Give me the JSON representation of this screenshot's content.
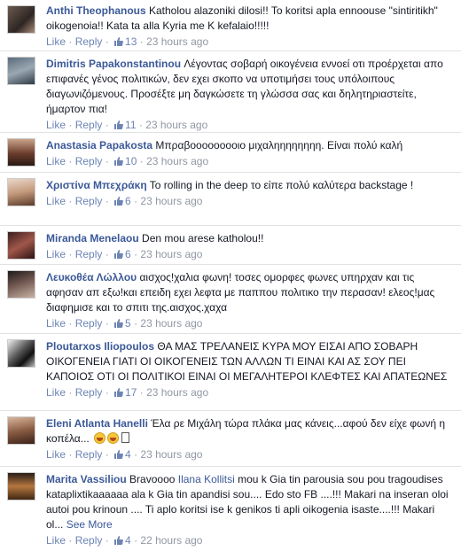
{
  "meta_labels": {
    "like": "Like",
    "reply": "Reply",
    "see_more": "See More"
  },
  "comments": [
    {
      "name": "Anthi Theophanous",
      "text": "Katholou alazoniki dilosi!! To koritsi apla ennoouse \"sintiritikh\" oikogenoia!! Kata ta alla Kyria me K kefalaio!!!!!",
      "likes": "13",
      "time": "23 hours ago"
    },
    {
      "name": "Dimitris Papakonstantinou",
      "text": "Λέγοντας σοβαρή οικογένεια εννοεί οτι προέρχεται απο επιφανές γένος πολιτικών, δεν εχει σκοπο να υποτιμήσει τους υπόλοιπους διαγωνιζόμενους. Προσέξτε μη δαγκώσετε τη γλώσσα σας και δηλητηριαστείτε, ήμαρτον πια!",
      "likes": "11",
      "time": "23 hours ago"
    },
    {
      "name": "Anastasia Papakosta",
      "text": "Μπραβοοοοοοοοιο μιχαληηηηηηηη. Είναι πολύ καλή",
      "likes": "10",
      "time": "23 hours ago"
    },
    {
      "name": "Χριστίνα Μπεχράκη",
      "text": "Το rolling in the deep το είπε πολύ καλύτερα backstage !",
      "likes": "6",
      "time": "23 hours ago"
    },
    {
      "name": "Miranda Menelaou",
      "text": "Den mou arese katholou!!",
      "likes": "6",
      "time": "23 hours ago"
    },
    {
      "name": "Λευκοθέα Λώλλου",
      "text": "αισχος!χαλια φωνη! τοσες ομορφες φωνες υπηρχαν και τις αφησαν απ εξω!και επειδη εχει λεφτα με παππου πολιτικο την περασαν! ελεος!μας διαφημισε και το σπιτι της.αισχος.χαχα",
      "likes": "5",
      "time": "23 hours ago"
    },
    {
      "name": "Ploutarxos Iliopoulos",
      "text": "ΘΑ ΜΑΣ ΤΡΕΛΑΝΕΙΣ ΚΥΡΑ ΜΟΥ ΕΙΣΑΙ ΑΠΟ ΣΟΒΑΡΗ ΟΙΚΟΓΕΝΕΙΑ ΓΙΑΤΙ ΟΙ ΟΙΚΟΓΕΝΕΙΣ ΤΩΝ ΑΛΛΩΝ ΤΙ ΕΙΝΑΙ ΚΑΙ ΑΣ ΣΟΥ ΠΕΙ ΚΑΠΟΙΟΣ ΟΤΙ ΟΙ ΠΟΛΙΤΙΚΟΙ ΕΙΝΑΙ ΟΙ ΜΕΓΑΛΗΤΕΡΟΙ ΚΛΕΦΤΕΣ ΚΑΙ ΑΠΑΤΕΩΝΕΣ",
      "likes": "17",
      "time": "23 hours ago"
    },
    {
      "name": "Eleni Atlanta Hanelli",
      "text": "Έλα ρε Μιχάλη τώρα πλάκα μας κάνεις...αφού δεν είχε φωνή η κοπέλα...",
      "likes": "4",
      "time": "23 hours ago"
    },
    {
      "name": "Marita Vassiliou",
      "text_before": "Bravoooo ",
      "mention": "Ilana Kollitsi",
      "text": " mou k Gia tin parousia sou pou tragoudises kataplixtikaaaaaa ala k Gia tin apandisi sou.... Edo sto FB ....!!! Makari na inseran oloi autoi pou krinoun .... Ti aplo koritsi ise k genikos ti apli oikogenia isaste....!!! Makari ol...",
      "likes": "4",
      "time": "22 hours ago"
    }
  ]
}
